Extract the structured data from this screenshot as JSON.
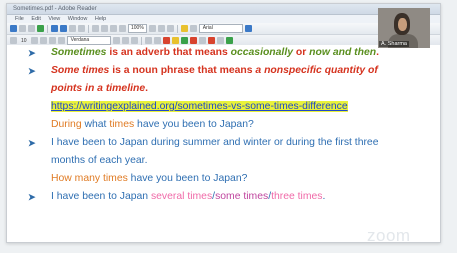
{
  "app": {
    "title": "Sometimes.pdf - Adobe Reader",
    "menu": [
      "File",
      "Edit",
      "View",
      "Window",
      "Help"
    ],
    "zoom": "100%",
    "font_name": "Verdana",
    "font_name_2": "Arial",
    "font_size": "10"
  },
  "video": {
    "participant_name": "A. Sharma"
  },
  "document": {
    "line1": {
      "a": "Sometimes",
      "b": " is an adverb that means ",
      "c": "occasionally",
      "d": " or ",
      "e": "now and then",
      "f": "."
    },
    "line2": {
      "a": "Some times",
      "b": " is a noun phrase that means ",
      "c": "a nonspecific quantity of"
    },
    "line3": "points in a timeline",
    "line3_end": ".",
    "link": "https://writingexplained.org/sometimes-vs-some-times-difference",
    "ex1": {
      "a": "During",
      "b": " what ",
      "c": "times",
      "d": " have you been to Japan?"
    },
    "ex2": "I have been to Japan during summer and winter or during the first three",
    "ex2b": "months of each year.",
    "ex3": {
      "a": "How many times",
      "b": " have you been to Japan?"
    },
    "ex4": {
      "a": "I have been to Japan ",
      "b": "several times",
      "c": "/",
      "d": "some times",
      "e": "/",
      "f": "three times",
      "g": "."
    }
  },
  "watermark": "zoom",
  "colors": {
    "red": "#d5331f",
    "green": "#5a8f1f",
    "orange": "#e07b24",
    "blue": "#2f6fb2",
    "pink": "#f06aa8",
    "link_highlight": "#e9f23a"
  }
}
